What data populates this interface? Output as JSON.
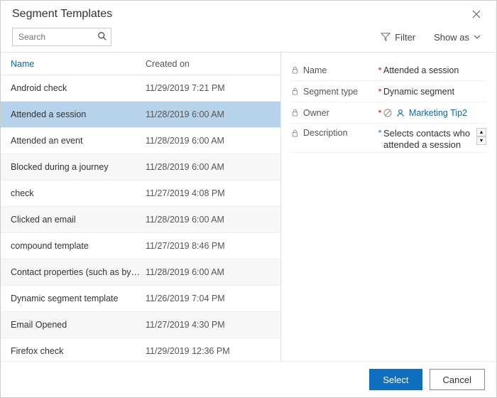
{
  "title": "Segment Templates",
  "search": {
    "placeholder": "Search"
  },
  "toolbar": {
    "filter_label": "Filter",
    "showas_label": "Show as"
  },
  "columns": {
    "name": "Name",
    "created": "Created on"
  },
  "rows": [
    {
      "name": "Android check",
      "created": "11/29/2019 7:21 PM"
    },
    {
      "name": "Attended a session",
      "created": "11/28/2019 6:00 AM"
    },
    {
      "name": "Attended an event",
      "created": "11/28/2019 6:00 AM"
    },
    {
      "name": "Blocked during a journey",
      "created": "11/28/2019 6:00 AM"
    },
    {
      "name": "check",
      "created": "11/27/2019 4:08 PM"
    },
    {
      "name": "Clicked an email",
      "created": "11/28/2019 6:00 AM"
    },
    {
      "name": "compound template",
      "created": "11/27/2019 8:46 PM"
    },
    {
      "name": "Contact properties (such as by city)",
      "created": "11/28/2019 6:00 AM"
    },
    {
      "name": "Dynamic segment template",
      "created": "11/26/2019 7:04 PM"
    },
    {
      "name": "Email Opened",
      "created": "11/27/2019 4:30 PM"
    },
    {
      "name": "Firefox check",
      "created": "11/29/2019 12:36 PM"
    }
  ],
  "selected_index": 1,
  "details": {
    "name_label": "Name",
    "name_value": "Attended a session",
    "segment_type_label": "Segment type",
    "segment_type_value": "Dynamic segment",
    "owner_label": "Owner",
    "owner_value": "Marketing Tip2",
    "description_label": "Description",
    "description_value": "Selects contacts who attended a session"
  },
  "footer": {
    "select_label": "Select",
    "cancel_label": "Cancel"
  }
}
